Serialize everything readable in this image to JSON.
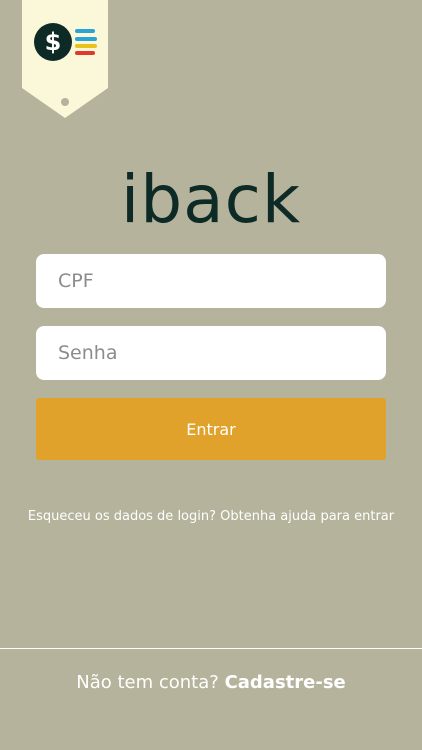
{
  "brand": {
    "name": "iback",
    "badge_symbol": "$",
    "badge_icon": "dollar-coin-icon",
    "colors": {
      "badge_bg": "#fbf7d9",
      "badge_dot": "#b5b39b",
      "coin": "#0e2a26",
      "stripe_blue": "#2aa3d8",
      "stripe_yellow": "#e9c21c",
      "stripe_red": "#e0392b"
    }
  },
  "login": {
    "cpf_placeholder": "CPF",
    "password_placeholder": "Senha",
    "submit_label": "Entrar",
    "help_text": "Esqueceu os dados de login? Obtenha ajuda para entrar"
  },
  "footer": {
    "prompt": "Não tem conta?",
    "signup_label": "Cadastre-se"
  },
  "theme": {
    "background": "#b5b39b",
    "accent": "#e0a22a",
    "logo_text": "#0e2a26"
  }
}
